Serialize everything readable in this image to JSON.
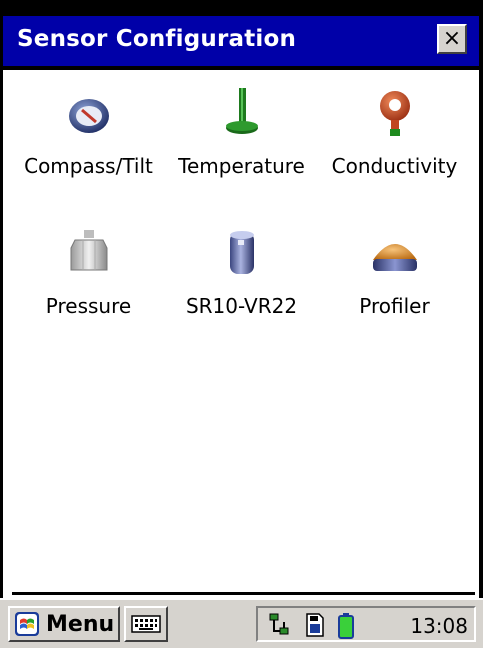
{
  "window": {
    "title": "Sensor Configuration",
    "close_symbol": "×"
  },
  "sensors": [
    {
      "label": "Compass/Tilt",
      "icon": "compass-icon"
    },
    {
      "label": "Temperature",
      "icon": "temperature-probe-icon"
    },
    {
      "label": "Conductivity",
      "icon": "conductivity-sensor-icon"
    },
    {
      "label": "Pressure",
      "icon": "pressure-sensor-icon"
    },
    {
      "label": "SR10-VR22",
      "icon": "sr10-vr22-cylinder-icon"
    },
    {
      "label": "Profiler",
      "icon": "profiler-dome-icon"
    }
  ],
  "taskbar": {
    "menu_label": "Menu",
    "clock": "13:08"
  },
  "colors": {
    "title_bar": "#0000a8",
    "taskbar": "#d6d3ce"
  }
}
